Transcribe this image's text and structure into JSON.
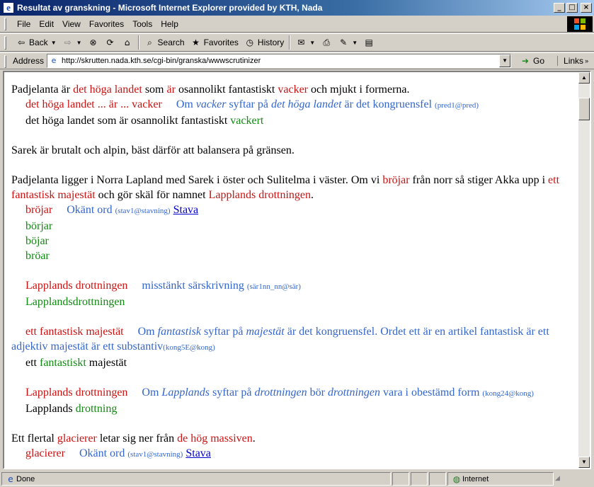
{
  "window": {
    "title": "Resultat av granskning - Microsoft Internet Explorer provided by KTH, Nada",
    "min_glyph": "_",
    "max_glyph": "□",
    "close_glyph": "×"
  },
  "menu": [
    "File",
    "Edit",
    "View",
    "Favorites",
    "Tools",
    "Help"
  ],
  "toolbar": {
    "back": "Back",
    "search": "Search",
    "favorites": "Favorites",
    "history": "History"
  },
  "address": {
    "label": "Address",
    "url": "http://skrutten.nada.kth.se/cgi-bin/granska/wwwscrutinizer",
    "go": "Go",
    "links": "Links"
  },
  "content": {
    "p1": {
      "t1": "Padjelanta är ",
      "e1": "det höga landet",
      "t2": " som ",
      "e2": "är",
      "t3": " osannolikt fantastiskt ",
      "e3": "vacker",
      "t4": " och mjukt i formerna."
    },
    "err1": {
      "phrase": "det höga landet ... är ... vacker",
      "m1": "Om ",
      "m2": "vacker",
      "m3": " syftar på ",
      "m4": "det höga landet",
      "m5": " är det kongruensfel",
      "code": "(pred1@pred)",
      "s1": "det höga landet som är osannolikt fantastiskt ",
      "s2": "vackert"
    },
    "p2": "Sarek är brutalt och alpin, bäst därför att balansera på gränsen.",
    "p3": {
      "t1": "Padjelanta ligger i Norra Lapland med Sarek i öster och Sulitelma i väster. Om vi ",
      "e1": "bröjar",
      "t2": " från norr så stiger Akka upp i ",
      "e2": "ett fantastisk majestät",
      "t3": " och gör skäl för namnet ",
      "e3": "Lapplands drottningen",
      "t4": "."
    },
    "err2": {
      "word": "bröjar",
      "msg": "Okänt ord",
      "code": "(stav1@stavning)",
      "link": "Stava",
      "sug1": "börjar",
      "sug2": "böjar",
      "sug3": "bröar"
    },
    "err3": {
      "word": "Lapplands drottningen",
      "msg": "misstänkt särskrivning",
      "code": "(sär1nn_nn@sär)",
      "sug": "Lapplandsdrottningen"
    },
    "err4": {
      "word": "ett fantastisk majestät",
      "m1": "Om ",
      "m2": "fantastisk",
      "m3": " syftar på ",
      "m4": "majestät",
      "m5": " är det kongruensfel. Ordet ett är en artikel",
      "m6": "fantastisk är ett adjektiv majestät är ett substantiv",
      "code": "(kong5E@kong)",
      "s1": "ett ",
      "s2": "fantastiskt",
      "s3": " majestät"
    },
    "err5": {
      "word": "Lapplands drottningen",
      "m1": "Om ",
      "m2": "Lapplands",
      "m3": " syftar på ",
      "m4": "drottningen",
      "m5": " bör ",
      "m6": "drottningen",
      "m7": " vara i obestämd form",
      "code": "(kong24@kong)",
      "s1": "Lapplands ",
      "s2": "drottning"
    },
    "p4": {
      "t1": "Ett flertal ",
      "e1": "glacierer",
      "t2": " letar sig ner från ",
      "e2": "de hög massiven",
      "t3": "."
    },
    "err6": {
      "word": "glacierer",
      "msg": "Okänt ord",
      "code": "(stav1@stavning)",
      "link": "Stava"
    }
  },
  "status": {
    "text": "Done",
    "zone": "Internet"
  }
}
